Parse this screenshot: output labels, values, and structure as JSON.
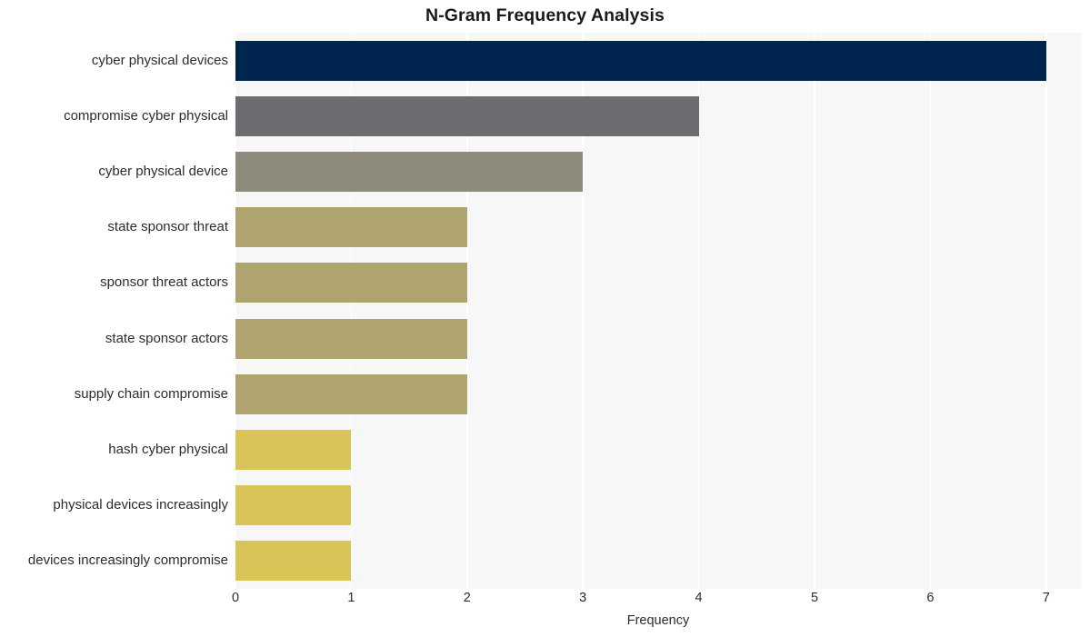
{
  "chart_data": {
    "type": "bar",
    "orientation": "horizontal",
    "title": "N-Gram Frequency Analysis",
    "xlabel": "Frequency",
    "ylabel": "",
    "categories": [
      "cyber physical devices",
      "compromise cyber physical",
      "cyber physical device",
      "state sponsor threat",
      "sponsor threat actors",
      "state sponsor actors",
      "supply chain compromise",
      "hash cyber physical",
      "physical devices increasingly",
      "devices increasingly compromise"
    ],
    "values": [
      7,
      4,
      3,
      2,
      2,
      2,
      2,
      1,
      1,
      1
    ],
    "bar_colors": [
      "#00254f",
      "#6b6c70",
      "#8e8a7c",
      "#afa470",
      "#afa470",
      "#afa470",
      "#afa470",
      "#d9c458",
      "#d9c458",
      "#d9c458"
    ],
    "xlim": [
      0,
      7.3
    ],
    "xticks": [
      0,
      1,
      2,
      3,
      4,
      5,
      6,
      7
    ],
    "xtick_labels": [
      "0",
      "1",
      "2",
      "3",
      "4",
      "5",
      "6",
      "7"
    ],
    "grid": "vertical-white",
    "legend": null,
    "plot_background": "#f7f7f7",
    "page_background": "#ffffff",
    "gridline_color": "#ffffff",
    "text_color": "#2b2b30",
    "title_color": "#1a1a1a"
  }
}
